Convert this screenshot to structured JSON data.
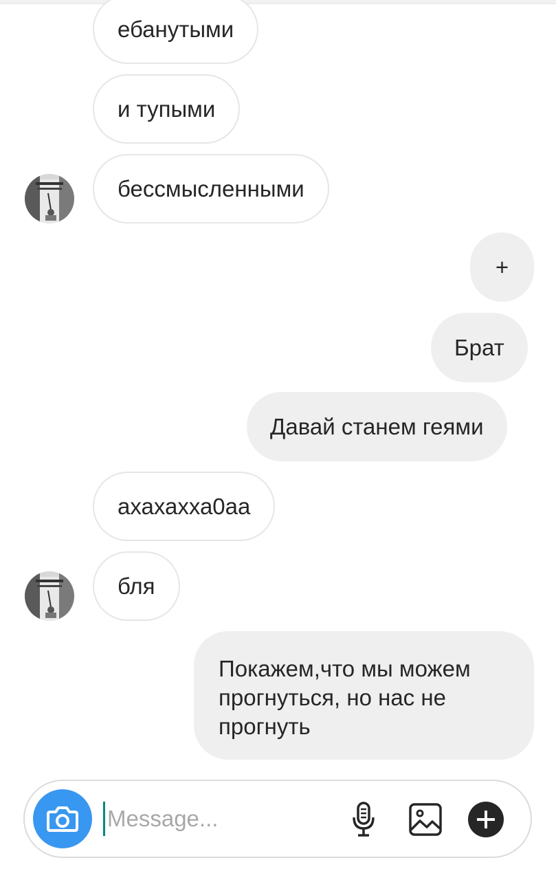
{
  "messages": [
    {
      "direction": "incoming",
      "text": "ебанутыми"
    },
    {
      "direction": "incoming",
      "text": "и тупыми"
    },
    {
      "direction": "incoming",
      "text": "бессмысленными",
      "avatar": true
    },
    {
      "direction": "outgoing",
      "text": "+"
    },
    {
      "direction": "outgoing",
      "text": "Брат"
    },
    {
      "direction": "outgoing",
      "text": "Давай станем геями"
    },
    {
      "direction": "incoming",
      "text": "ахахахха0аа"
    },
    {
      "direction": "incoming",
      "text": "бля",
      "avatar": true
    },
    {
      "direction": "outgoing",
      "text": "Покажем,что мы можем прогнуться, но нас не прогнуть"
    }
  ],
  "composer": {
    "placeholder": "Message...",
    "value": ""
  },
  "icons": {
    "camera": "camera-icon",
    "mic": "microphone-icon",
    "gallery": "image-gallery-icon",
    "more": "plus-circle-icon"
  },
  "colors": {
    "accent": "#3897f0",
    "outgoing_bubble": "#efefef",
    "incoming_border": "#e6e6e6",
    "caret": "#00897b"
  }
}
